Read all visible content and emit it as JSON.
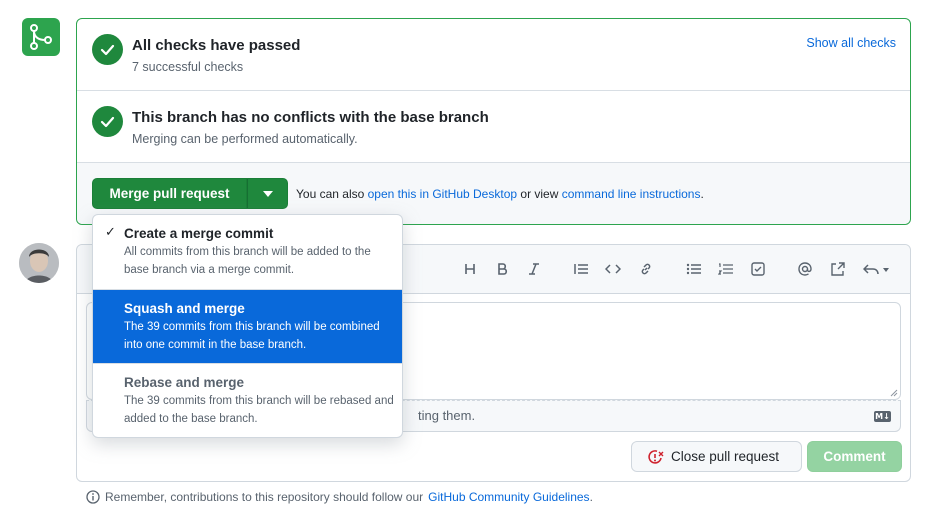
{
  "checks": {
    "title": "All checks have passed",
    "subtitle": "7 successful checks",
    "show_all": "Show all checks"
  },
  "conflicts": {
    "title": "This branch has no conflicts with the base branch",
    "subtitle": "Merging can be performed automatically."
  },
  "merge": {
    "button_label": "Merge pull request",
    "also_prefix": "You can also",
    "desktop_link": "open this in GitHub Desktop",
    "or_view": "or view",
    "cli_link": "command line instructions",
    "period": "."
  },
  "merge_menu": [
    {
      "title": "Create a merge commit",
      "description": "All commits from this branch will be added to the base branch via a merge commit.",
      "selected": true,
      "highlighted": false
    },
    {
      "title": "Squash and merge",
      "description": "The 39 commits from this branch will be combined into one commit in the base branch.",
      "selected": false,
      "highlighted": true
    },
    {
      "title": "Rebase and merge",
      "description": "The 39 commits from this branch will be rebased and added to the base branch.",
      "selected": false,
      "highlighted": false
    }
  ],
  "editor": {
    "attach_hint_visible": "ting them.",
    "markdown_icon": "markdown-icon",
    "toolbar_icons": [
      "heading-icon",
      "bold-icon",
      "italic-icon",
      "quote-icon",
      "code-icon",
      "link-icon",
      "unordered-list-icon",
      "ordered-list-icon",
      "task-list-icon",
      "mention-icon",
      "cross-reference-icon",
      "reply-icon"
    ]
  },
  "actions": {
    "close_pr": "Close pull request",
    "comment": "Comment"
  },
  "footer": {
    "remember": "Remember, contributions to this repository should follow our",
    "guidelines_link": "GitHub Community Guidelines",
    "period": "."
  },
  "colors": {
    "success": "#1f883d",
    "link": "#0969da",
    "highlight": "#0969da",
    "danger": "#cf222e",
    "comment_disabled": "#94d3a2"
  }
}
